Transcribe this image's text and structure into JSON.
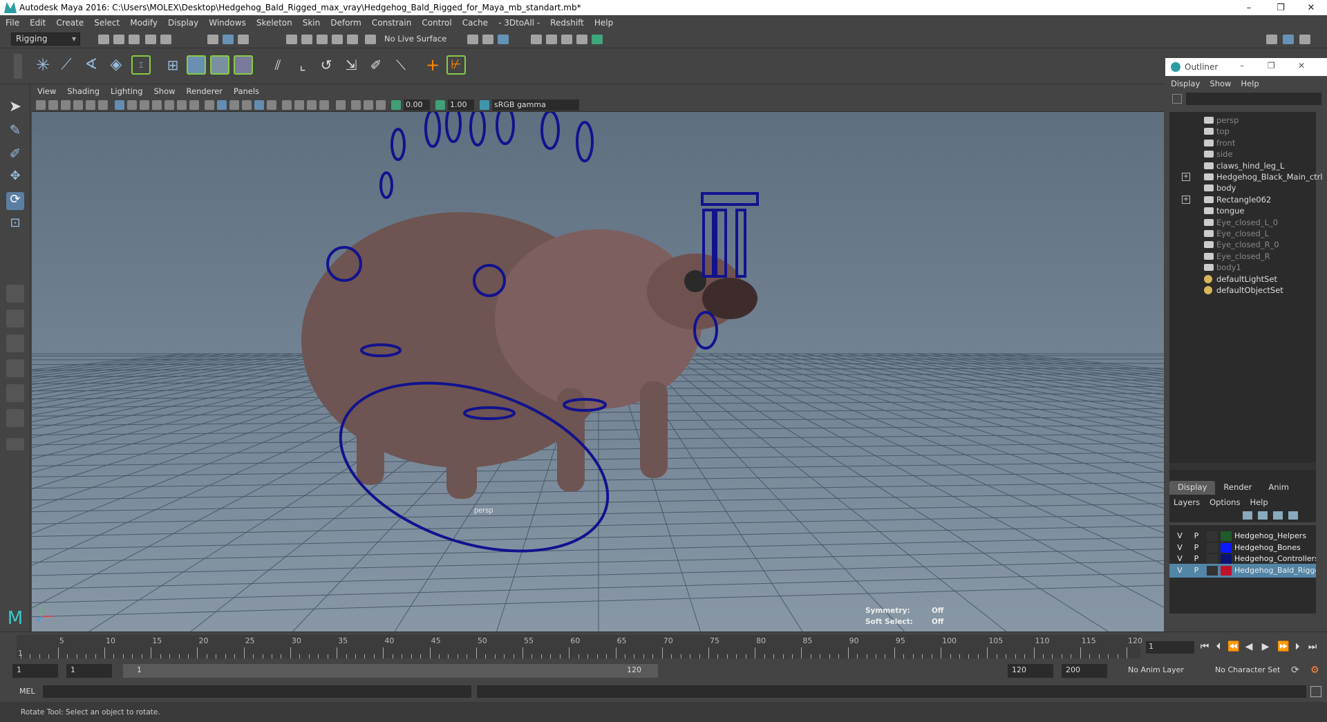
{
  "window": {
    "title": "Autodesk Maya 2016: C:\\Users\\MOLEX\\Desktop\\Hedgehog_Bald_Rigged_max_vray\\Hedgehog_Bald_Rigged_for_Maya_mb_standart.mb*",
    "controls": {
      "minimize": "–",
      "restore": "❐",
      "close": "✕"
    }
  },
  "menubar": [
    "File",
    "Edit",
    "Create",
    "Select",
    "Modify",
    "Display",
    "Windows",
    "Skeleton",
    "Skin",
    "Deform",
    "Constrain",
    "Control",
    "Cache",
    "- 3DtoAll -",
    "Redshift",
    "Help"
  ],
  "statusline": {
    "mode": "Rigging",
    "live_surface": "No Live Surface"
  },
  "viewport": {
    "menu": [
      "View",
      "Shading",
      "Lighting",
      "Show",
      "Renderer",
      "Panels"
    ],
    "near_value": "0.00",
    "far_value": "1.00",
    "color_space": "sRGB gamma",
    "camera_label": "persp",
    "hud": [
      {
        "label": "Symmetry:",
        "value": "Off"
      },
      {
        "label": "Soft Select:",
        "value": "Off"
      }
    ]
  },
  "outliner": {
    "title": "Outliner",
    "menu": [
      "Display",
      "Show",
      "Help"
    ],
    "items": [
      {
        "name": "persp",
        "dim": true,
        "expand": false,
        "icon": "camera-icon"
      },
      {
        "name": "top",
        "dim": true,
        "expand": false,
        "icon": "camera-icon"
      },
      {
        "name": "front",
        "dim": true,
        "expand": false,
        "icon": "camera-icon"
      },
      {
        "name": "side",
        "dim": true,
        "expand": false,
        "icon": "camera-icon"
      },
      {
        "name": "claws_hind_leg_L",
        "dim": false,
        "expand": false,
        "icon": "transform-icon"
      },
      {
        "name": "Hedgehog_Black_Main_ctrl",
        "dim": false,
        "expand": true,
        "icon": "transform-icon"
      },
      {
        "name": "body",
        "dim": false,
        "expand": false,
        "icon": "transform-icon"
      },
      {
        "name": "Rectangle062",
        "dim": false,
        "expand": true,
        "icon": "transform-icon"
      },
      {
        "name": "tongue",
        "dim": false,
        "expand": false,
        "icon": "transform-icon"
      },
      {
        "name": "Eye_closed_L_0",
        "dim": true,
        "expand": false,
        "icon": "transform-icon"
      },
      {
        "name": "Eye_closed_L",
        "dim": true,
        "expand": false,
        "icon": "transform-icon"
      },
      {
        "name": "Eye_closed_R_0",
        "dim": true,
        "expand": false,
        "icon": "transform-icon"
      },
      {
        "name": "Eye_closed_R",
        "dim": true,
        "expand": false,
        "icon": "transform-icon"
      },
      {
        "name": "body1",
        "dim": true,
        "expand": false,
        "icon": "transform-icon"
      },
      {
        "name": "defaultLightSet",
        "dim": false,
        "expand": false,
        "icon": "set-icon"
      },
      {
        "name": "defaultObjectSet",
        "dim": false,
        "expand": false,
        "icon": "set-icon"
      }
    ]
  },
  "layers": {
    "tabs": [
      "Display",
      "Render",
      "Anim"
    ],
    "menu": [
      "Layers",
      "Options",
      "Help"
    ],
    "rows": [
      {
        "v": "V",
        "p": "P",
        "name": "Hedgehog_Helpers",
        "color": "#1f5a2a",
        "selected": false
      },
      {
        "v": "V",
        "p": "P",
        "name": "Hedgehog_Bones",
        "color": "#0a1aff",
        "selected": false
      },
      {
        "v": "V",
        "p": "P",
        "name": "Hedgehog_Controllers",
        "color": "#0a1470",
        "selected": false
      },
      {
        "v": "V",
        "p": "P",
        "name": "Hedgehog_Bald_Rigged",
        "color": "#c0102a",
        "selected": true
      }
    ]
  },
  "timeline": {
    "labels": [
      "5",
      "10",
      "15",
      "20",
      "25",
      "30",
      "35",
      "40",
      "45",
      "50",
      "55",
      "60",
      "65",
      "70",
      "75",
      "80",
      "85",
      "90",
      "95",
      "100",
      "105",
      "110",
      "115",
      "120"
    ],
    "current_frame": "1",
    "first_label": "1"
  },
  "range": {
    "start": "1",
    "playback_start": "1",
    "slider_start": "1",
    "slider_end": "120",
    "playback_end": "120",
    "end": "200",
    "anim_layer": "No Anim Layer",
    "character_set": "No Character Set"
  },
  "command": {
    "label": "MEL"
  },
  "help": {
    "text": "Rotate Tool: Select an object to rotate."
  }
}
